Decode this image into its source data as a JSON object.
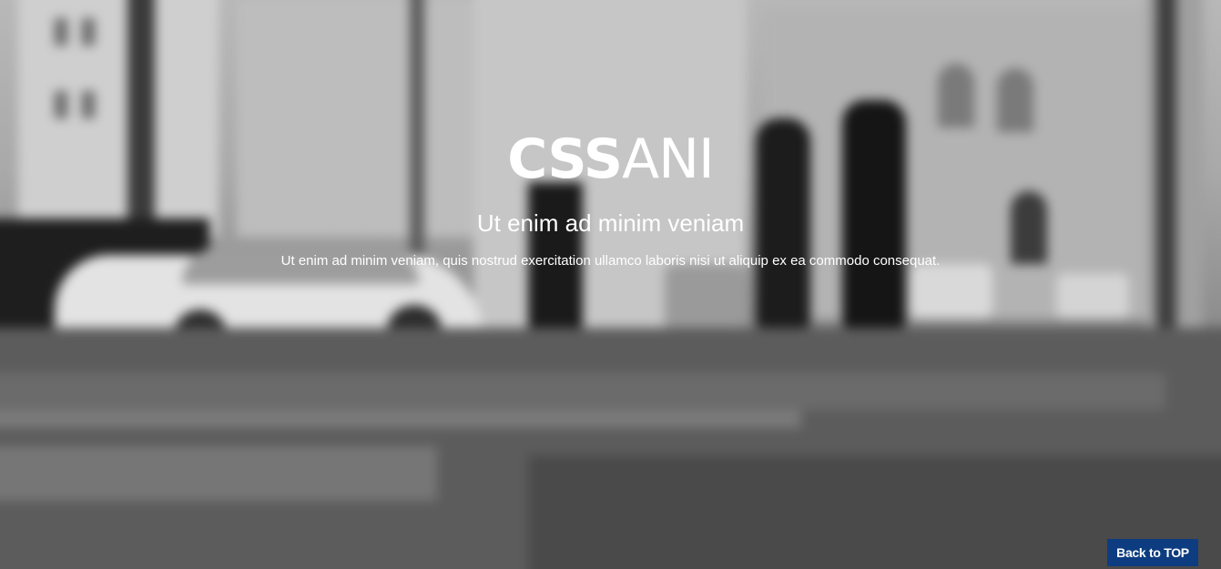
{
  "hero": {
    "brand_bold": "CSS",
    "brand_light": "ANI",
    "subtitle": "Ut enim ad minim veniam",
    "description": "Ut enim ad minim veniam, quis nostrud exercitation ullamco laboris nisi ut aliquip ex ea commodo consequat."
  },
  "back_to_top": {
    "label": "Back to TOP"
  },
  "colors": {
    "back_to_top_bg": "#0d3d80",
    "text": "#ffffff"
  }
}
